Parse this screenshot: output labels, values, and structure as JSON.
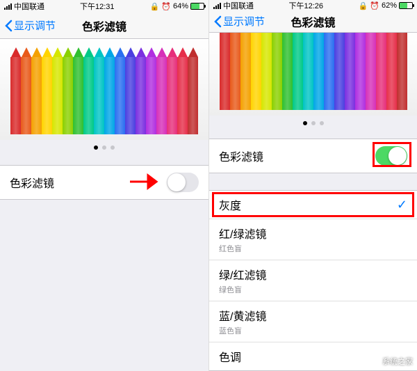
{
  "left": {
    "status": {
      "carrier": "中国联通",
      "time": "下午12:31",
      "battery_pct": "64%"
    },
    "nav": {
      "back": "显示调节",
      "title": "色彩滤镜"
    },
    "toggle": {
      "label": "色彩滤镜",
      "on": false
    }
  },
  "right": {
    "status": {
      "carrier": "中国联通",
      "time": "下午12:26",
      "battery_pct": "62%"
    },
    "nav": {
      "back": "显示调节",
      "title": "色彩滤镜"
    },
    "toggle": {
      "label": "色彩滤镜",
      "on": true
    },
    "options": [
      {
        "label": "灰度",
        "sub": "",
        "checked": true
      },
      {
        "label": "红/绿滤镜",
        "sub": "红色盲",
        "checked": false
      },
      {
        "label": "绿/红滤镜",
        "sub": "绿色盲",
        "checked": false
      },
      {
        "label": "蓝/黄滤镜",
        "sub": "蓝色盲",
        "checked": false
      },
      {
        "label": "色调",
        "sub": "",
        "checked": false
      }
    ]
  },
  "pencil_colors": [
    "#d92b2b",
    "#e85a1a",
    "#f4a100",
    "#ffd400",
    "#d6e600",
    "#8bd000",
    "#2fbf2f",
    "#00c987",
    "#00c4c4",
    "#00a6e6",
    "#2a6ff0",
    "#4b3fe0",
    "#7b2fe0",
    "#b02fe0",
    "#d62fb8",
    "#e62f7a",
    "#e62f4a",
    "#c02f2f"
  ],
  "icons": {
    "alarm": "⏰",
    "lock": "🔒"
  },
  "watermark": "系统之家"
}
